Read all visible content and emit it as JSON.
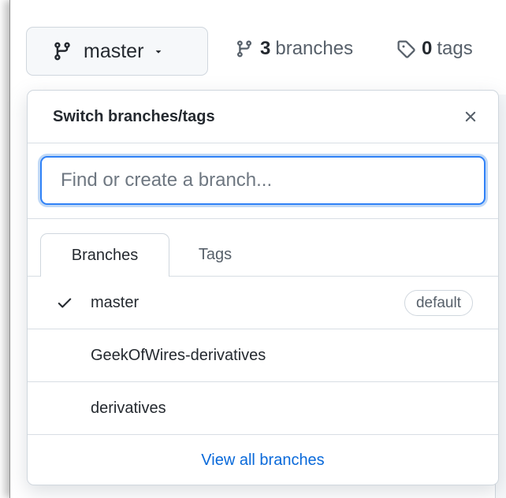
{
  "header": {
    "branch_button": {
      "label": "master",
      "icon": "git-branch-icon"
    },
    "branches_link": {
      "count": "3",
      "label": "branches"
    },
    "tags_link": {
      "count": "0",
      "label": "tags"
    }
  },
  "menu": {
    "title": "Switch branches/tags",
    "filter": {
      "placeholder": "Find or create a branch...",
      "value": ""
    },
    "tabs": [
      {
        "label": "Branches",
        "active": true
      },
      {
        "label": "Tags",
        "active": false
      }
    ],
    "branches": [
      {
        "name": "master",
        "selected": true,
        "badge": "default"
      },
      {
        "name": "GeekOfWires-derivatives",
        "selected": false
      },
      {
        "name": "derivatives",
        "selected": false
      }
    ],
    "footer_link": "View all branches"
  },
  "colors": {
    "accent": "#0969da",
    "focus_border": "#2f81f7",
    "border": "#d0d7de",
    "text": "#24292f",
    "muted": "#57606a"
  }
}
